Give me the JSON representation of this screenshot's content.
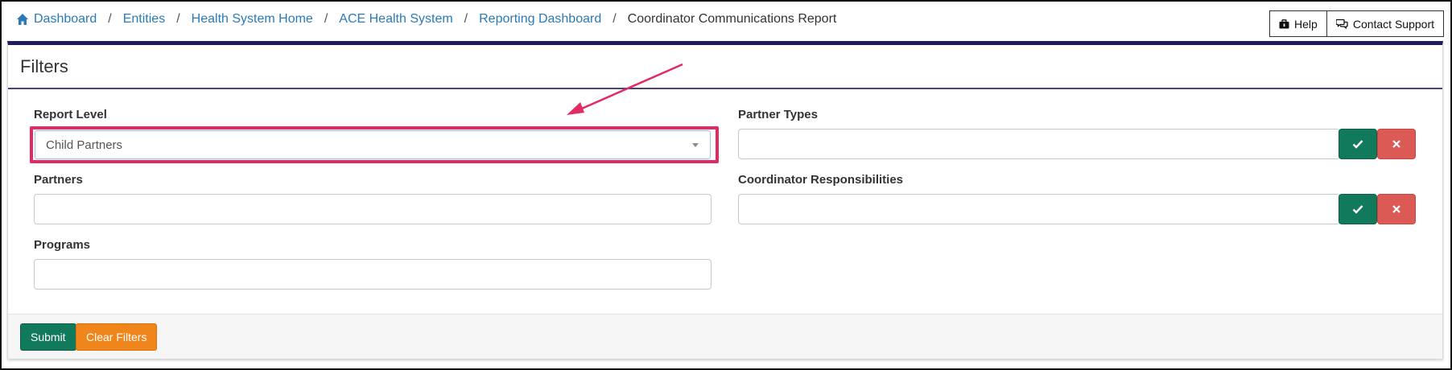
{
  "breadcrumb": {
    "items": [
      {
        "label": "Dashboard",
        "icon": "home-icon"
      },
      {
        "label": "Entities"
      },
      {
        "label": "Health System Home"
      },
      {
        "label": "ACE Health System"
      },
      {
        "label": "Reporting Dashboard"
      }
    ],
    "separator": "/",
    "current": "Coordinator Communications Report"
  },
  "header_actions": {
    "help_label": "Help",
    "help_icon": "briefcase-icon",
    "support_label": "Contact Support",
    "support_icon": "chat-bubbles-icon"
  },
  "filters": {
    "title": "Filters",
    "report_level": {
      "label": "Report Level",
      "value": "Child Partners"
    },
    "partner_types": {
      "label": "Partner Types",
      "value": ""
    },
    "partners": {
      "label": "Partners",
      "value": ""
    },
    "coordinator_responsibilities": {
      "label": "Coordinator Responsibilities",
      "value": ""
    },
    "programs": {
      "label": "Programs",
      "value": ""
    }
  },
  "footer": {
    "submit_label": "Submit",
    "clear_label": "Clear Filters"
  },
  "colors": {
    "link": "#2a7ab8",
    "panel_border": "#1f1d5c",
    "success": "#127a5c",
    "danger": "#dc5a56",
    "warning": "#f0851c",
    "annotation": "#e22a63"
  }
}
